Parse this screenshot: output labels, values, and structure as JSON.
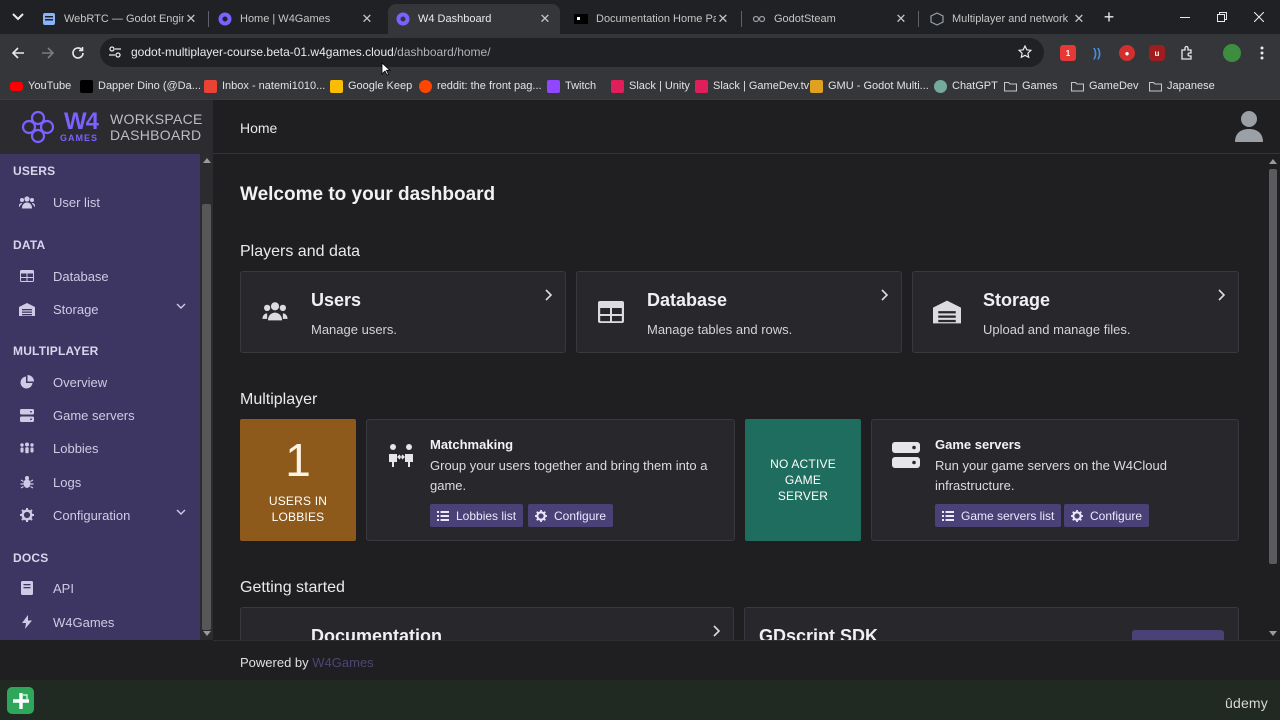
{
  "browser": {
    "tabs": [
      {
        "title": "WebRTC — Godot Engine",
        "icon": "godot-docs-favicon",
        "active": false
      },
      {
        "title": "Home | W4Games",
        "icon": "w4games-favicon",
        "active": false
      },
      {
        "title": "W4 Dashboard",
        "icon": "w4games-favicon",
        "active": true
      },
      {
        "title": "Documentation Home Pag",
        "icon": "documentation-favicon",
        "active": false
      },
      {
        "title": "GodotSteam",
        "icon": "godotsteam-favicon",
        "active": false
      },
      {
        "title": "Multiplayer and network",
        "icon": "godot-favicon",
        "active": false
      }
    ],
    "new_tab_symbol": "+",
    "url_host": "godot-multiplayer-course.beta-01.w4games.cloud",
    "url_path": "/dashboard/home/",
    "extension_badge": "1",
    "bookmarks": [
      {
        "label": "YouTube",
        "icon": "youtube-icon",
        "color": "#ff0000"
      },
      {
        "label": "Dapper Dino (@Da...",
        "icon": "x-icon",
        "color": "#000000"
      },
      {
        "label": "Inbox - natemi1010...",
        "icon": "gmail-icon",
        "color": "#ea4335"
      },
      {
        "label": "Google Keep",
        "icon": "keep-icon",
        "color": "#fbbc04"
      },
      {
        "label": "reddit: the front pag...",
        "icon": "reddit-icon",
        "color": "#ff4500"
      },
      {
        "label": "Twitch",
        "icon": "twitch-icon",
        "color": "#9146ff"
      },
      {
        "label": "Slack | Unity",
        "icon": "slack-icon",
        "color": "#e01e5a"
      },
      {
        "label": "Slack | GameDev.tv",
        "icon": "slack-icon",
        "color": "#e01e5a"
      },
      {
        "label": "GMU - Godot Multi...",
        "icon": "gmu-icon",
        "color": "#e0a020"
      },
      {
        "label": "ChatGPT",
        "icon": "chatgpt-icon",
        "color": "#74aa9c"
      },
      {
        "label": "Games",
        "icon": "folder-icon",
        "color": "#c4c7c5"
      },
      {
        "label": "GameDev",
        "icon": "folder-icon",
        "color": "#c4c7c5"
      },
      {
        "label": "Japanese",
        "icon": "folder-icon",
        "color": "#c4c7c5"
      }
    ]
  },
  "app": {
    "logo_main": "W4",
    "logo_sub": "GAMES",
    "logo_line1": "WORKSPACE",
    "logo_line2": "DASHBOARD",
    "breadcrumb": "Home",
    "accent": "#7b61ff",
    "sidebar_bg": "#3d3662"
  },
  "sidebar": {
    "sections": [
      {
        "title": "USERS",
        "items": [
          {
            "label": "User list",
            "icon": "users-icon"
          }
        ]
      },
      {
        "title": "DATA",
        "items": [
          {
            "label": "Database",
            "icon": "table-icon"
          },
          {
            "label": "Storage",
            "icon": "warehouse-icon",
            "expandable": true
          }
        ]
      },
      {
        "title": "MULTIPLAYER",
        "items": [
          {
            "label": "Overview",
            "icon": "pie-chart-icon"
          },
          {
            "label": "Game servers",
            "icon": "server-icon"
          },
          {
            "label": "Lobbies",
            "icon": "people-group-icon"
          },
          {
            "label": "Logs",
            "icon": "bug-icon"
          },
          {
            "label": "Configuration",
            "icon": "gear-icon",
            "expandable": true
          }
        ]
      },
      {
        "title": "DOCS",
        "items": [
          {
            "label": "API",
            "icon": "book-icon"
          },
          {
            "label": "W4Games",
            "icon": "bolt-icon"
          }
        ]
      }
    ]
  },
  "main": {
    "welcome": "Welcome to your dashboard",
    "players_heading": "Players and data",
    "cards": [
      {
        "title": "Users",
        "subtitle": "Manage users.",
        "icon": "users-icon"
      },
      {
        "title": "Database",
        "subtitle": "Manage tables and rows.",
        "icon": "table-icon"
      },
      {
        "title": "Storage",
        "subtitle": "Upload and manage files.",
        "icon": "warehouse-icon"
      }
    ],
    "multiplayer_heading": "Multiplayer",
    "lobbies_stat": {
      "value": "1",
      "label": "USERS IN LOBBIES",
      "color": "#8d5a1b"
    },
    "matchmaking": {
      "title": "Matchmaking",
      "desc": "Group your users together and bring them into a game.",
      "btn1": "Lobbies list",
      "btn2": "Configure"
    },
    "servers_stat": {
      "label": "NO ACTIVE GAME SERVER",
      "color": "#1e6d5e"
    },
    "game_servers": {
      "title": "Game servers",
      "desc": "Run your game servers on the W4Cloud infrastructure.",
      "btn1": "Game servers list",
      "btn2": "Configure"
    },
    "getting_started_heading": "Getting started",
    "gs_cards": [
      {
        "title": "Documentation"
      },
      {
        "title": "GDscript SDK"
      }
    ]
  },
  "footer": {
    "powered_by": "Powered by",
    "link": "W4Games"
  },
  "taskbar": {
    "udemy": "ûdemy"
  }
}
